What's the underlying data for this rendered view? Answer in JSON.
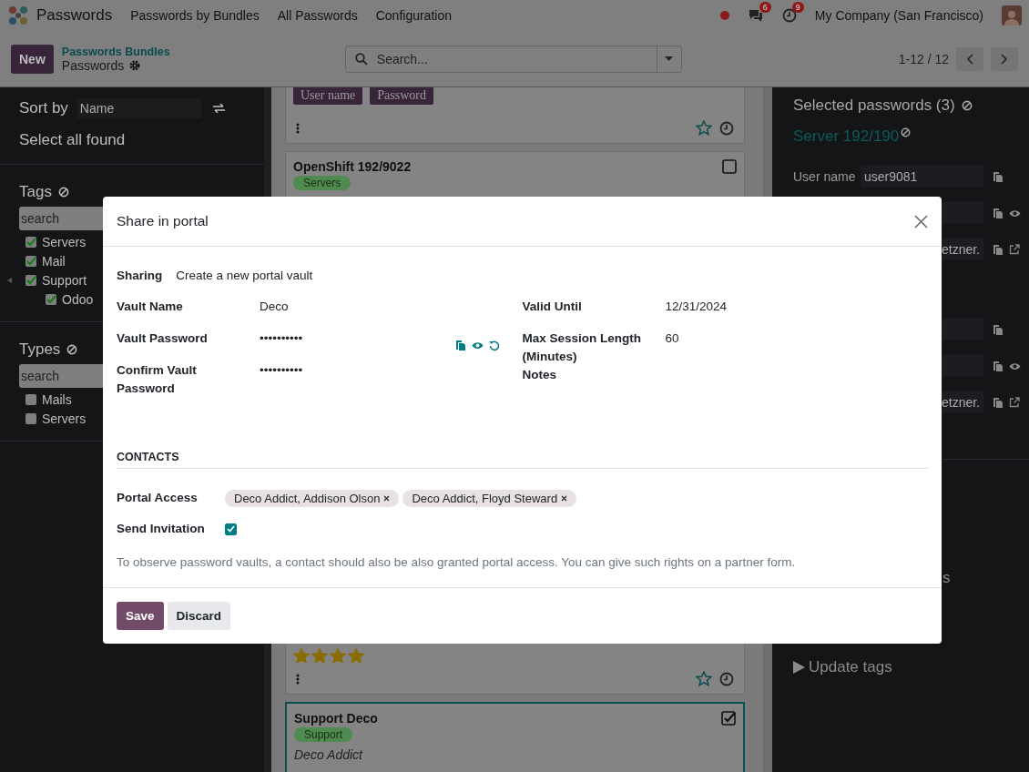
{
  "navbar": {
    "app_name": "Passwords",
    "menu": [
      "Passwords by Bundles",
      "All Passwords",
      "Configuration"
    ],
    "messages_badge": "6",
    "activities_badge": "9",
    "company": "My Company (San Francisco)"
  },
  "control_panel": {
    "new_button": "New",
    "breadcrumb": "Passwords Bundles",
    "current": "Passwords",
    "search": {
      "placeholder": "Search..."
    },
    "pager": "1-12 / 12"
  },
  "sidebar": {
    "sort_label": "Sort by",
    "sort_value": "Name",
    "select_all": "Select all found",
    "filters": [
      {
        "title": "Tags",
        "search_placeholder": "search",
        "items": [
          {
            "label": "Servers",
            "checked": true
          },
          {
            "label": "Mail",
            "checked": true
          },
          {
            "label": "Support",
            "checked": true,
            "children": [
              {
                "label": "Odoo",
                "checked": true
              }
            ]
          }
        ]
      },
      {
        "title": "Types",
        "search_placeholder": "search",
        "items": [
          {
            "label": "Mails",
            "checked": false
          },
          {
            "label": "Servers",
            "checked": false
          }
        ]
      }
    ]
  },
  "kanban": {
    "cards": [
      {
        "kind": "buttons",
        "buttons": [
          "User name",
          "Password"
        ]
      },
      {
        "kind": "record",
        "title": "OpenShift 192/9022",
        "tag": "Servers",
        "selected": false
      },
      {
        "kind": "rating",
        "stars": 4
      },
      {
        "kind": "record",
        "title": "Support Deco",
        "tag": "Support",
        "partner": "Deco Addict",
        "selected": true
      }
    ]
  },
  "right_panel": {
    "title": "Selected passwords (3)",
    "groups": [
      {
        "title": "Server 192/190",
        "rows": [
          {
            "label": "User name",
            "value": "user9081",
            "show": false,
            "open": false
          },
          {
            "show": true,
            "open": false
          },
          {
            "value": "etzner.",
            "show": false,
            "open": true
          }
        ]
      },
      {
        "rows": [
          {
            "show": false,
            "open": false
          },
          {
            "show": true,
            "open": false
          },
          {
            "value": "etzner.",
            "show": false,
            "open": true
          }
        ]
      }
    ],
    "links": [
      {
        "kind": "link",
        "label": "s"
      },
      {
        "kind": "toggle",
        "label": "Update tags"
      }
    ]
  },
  "dialog": {
    "title": "Share in portal",
    "sharing_label": "Sharing",
    "sharing_value": "Create a new portal vault",
    "left_fields": [
      {
        "label": "Vault Name",
        "value": "Deco",
        "tools": false
      },
      {
        "label": "Vault Password",
        "value": "••••••••••",
        "tools": true
      },
      {
        "label": "Confirm Vault Password",
        "value": "••••••••••",
        "tools": false
      }
    ],
    "right_fields": [
      {
        "label": "Valid Until",
        "value": "12/31/2024",
        "tools": false
      },
      {
        "label": "Max Session Length (Minutes)",
        "value": "60",
        "tools": false
      },
      {
        "label": "Notes",
        "tools": false
      }
    ],
    "contacts_title": "CONTACTS",
    "portal_access_label": "Portal Access",
    "portal_access": [
      "Deco Addict, Addison Olson",
      "Deco Addict, Floyd Steward"
    ],
    "send_invitation_label": "Send Invitation",
    "send_invitation": true,
    "help": "To observe password vaults, a contact should also be also granted portal access. You can give such rights on a partner form.",
    "buttons": [
      "Save",
      "Discard"
    ]
  }
}
